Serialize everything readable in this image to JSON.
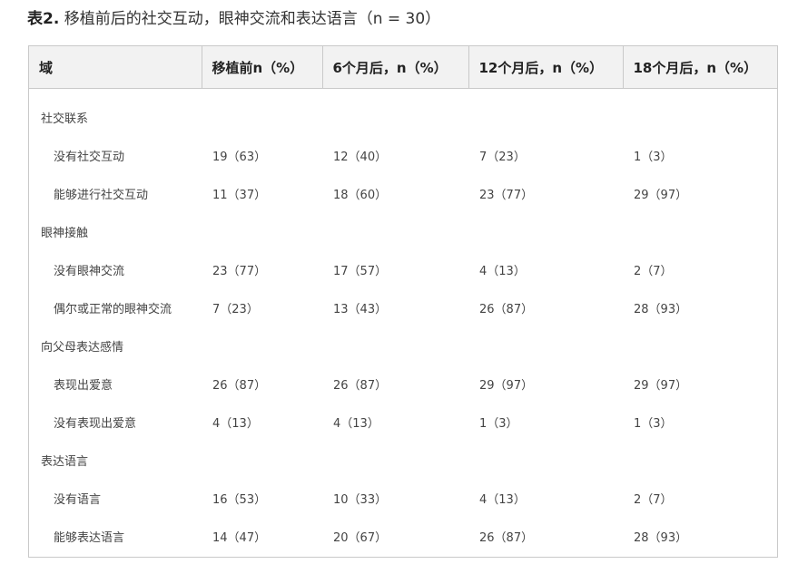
{
  "title": {
    "prefix": "表2.",
    "text": " 移植前后的社交互动，眼神交流和表达语言（n = 30）"
  },
  "table": {
    "headers": [
      "域",
      "移植前n（%）",
      "6个月后，n（%）",
      "12个月后，n（%）",
      "18个月后，n（%）"
    ],
    "groups": [
      {
        "category": "社交联系",
        "rows": [
          {
            "label": "没有社交互动",
            "values": [
              "19（63）",
              "12（40）",
              "7（23）",
              "1（3）"
            ]
          },
          {
            "label": "能够进行社交互动",
            "values": [
              "11（37）",
              "18（60）",
              "23（77）",
              "29（97）"
            ]
          }
        ]
      },
      {
        "category": "眼神接触",
        "rows": [
          {
            "label": "没有眼神交流",
            "values": [
              "23（77）",
              "17（57）",
              "4（13）",
              "2（7）"
            ]
          },
          {
            "label": "偶尔或正常的眼神交流",
            "values": [
              "7（23）",
              "13（43）",
              "26（87）",
              "28（93）"
            ]
          }
        ]
      },
      {
        "category": "向父母表达感情",
        "rows": [
          {
            "label": "表现出爱意",
            "values": [
              "26（87）",
              "26（87）",
              "29（97）",
              "29（97）"
            ]
          },
          {
            "label": "没有表现出爱意",
            "values": [
              "4（13）",
              "4（13）",
              "1（3）",
              "1（3）"
            ]
          }
        ]
      },
      {
        "category": "表达语言",
        "rows": [
          {
            "label": "没有语言",
            "values": [
              "16（53）",
              "10（33）",
              "4（13）",
              "2（7）"
            ]
          },
          {
            "label": "能够表达语言",
            "values": [
              "14（47）",
              "20（67）",
              "26（87）",
              "28（93）"
            ]
          }
        ]
      }
    ]
  }
}
